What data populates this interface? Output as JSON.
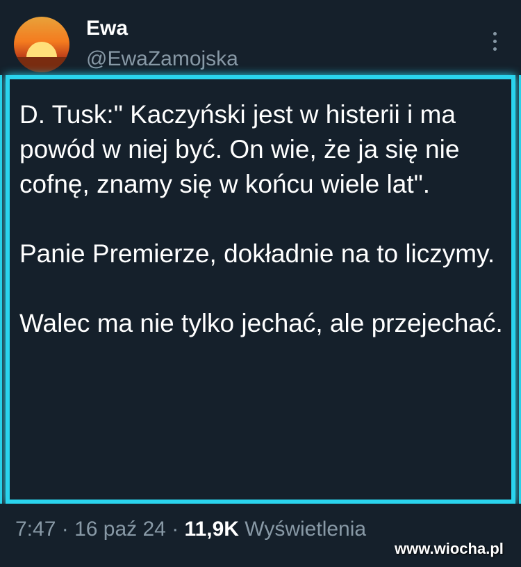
{
  "author": {
    "display_name": "Ewa",
    "handle": "@EwaZamojska",
    "avatar_icon": "sunset-avatar-icon"
  },
  "tweet": {
    "paragraphs": [
      "D. Tusk:\" Kaczyński jest w histerii i ma powód w niej być. On wie, że ja się nie cofnę, znamy się w końcu wiele lat\".",
      "Panie Premierze, dokładnie na to liczymy.",
      "Walec ma nie tylko jechać, ale przejechać."
    ]
  },
  "meta": {
    "time": "7:47",
    "separator": "·",
    "date": "16 paź 24",
    "views_count": "11,9K",
    "views_label": "Wyświetlenia"
  },
  "watermark": "www.wiocha.pl",
  "colors": {
    "accent_border": "#2ad4ee",
    "background": "#15202b",
    "muted_text": "#8899a6"
  }
}
